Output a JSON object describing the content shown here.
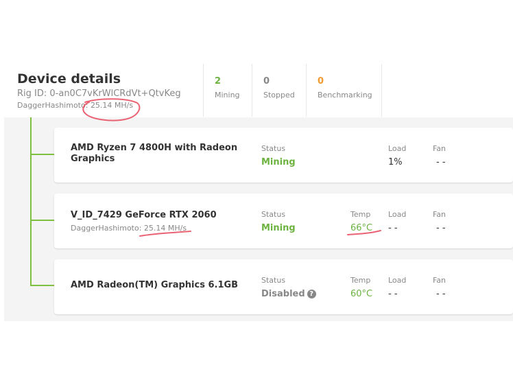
{
  "header": {
    "title": "Device details",
    "rig_id": "Rig ID: 0-an0C7vKrWlCRdVt+QtvKeg",
    "algo_label": "DaggerHashimoto:",
    "algo_rate": "25.14 MH/s"
  },
  "stats": [
    {
      "count": "2",
      "label": "Mining",
      "color": "#6cb33f"
    },
    {
      "count": "0",
      "label": "Stopped",
      "color": "#888888"
    },
    {
      "count": "0",
      "label": "Benchmarking",
      "color": "#f29a2e"
    }
  ],
  "devices": [
    {
      "name_line1": "AMD Ryzen 7 4800H with Radeon",
      "name_line2": "Graphics",
      "status_label": "Status",
      "status": "Mining",
      "load_label": "Load",
      "load": "1%",
      "fan_label": "Fan",
      "fan": "- -"
    },
    {
      "name": "V_ID_7429 GeForce RTX 2060",
      "algo": "DaggerHashimoto: 25.14 MH/s",
      "status_label": "Status",
      "status": "Mining",
      "temp_label": "Temp",
      "temp": "66°C",
      "load_label": "Load",
      "load": "- -",
      "fan_label": "Fan",
      "fan": "- -"
    },
    {
      "name": "AMD Radeon(TM) Graphics 6.1GB",
      "status_label": "Status",
      "status": "Disabled",
      "help_glyph": "?",
      "temp_label": "Temp",
      "temp": "60°C",
      "load_label": "Load",
      "load": "- -",
      "fan_label": "Fan",
      "fan": "- -"
    }
  ],
  "colors": {
    "accent_green": "#6cb33f",
    "annotation_red": "#e8485a"
  }
}
